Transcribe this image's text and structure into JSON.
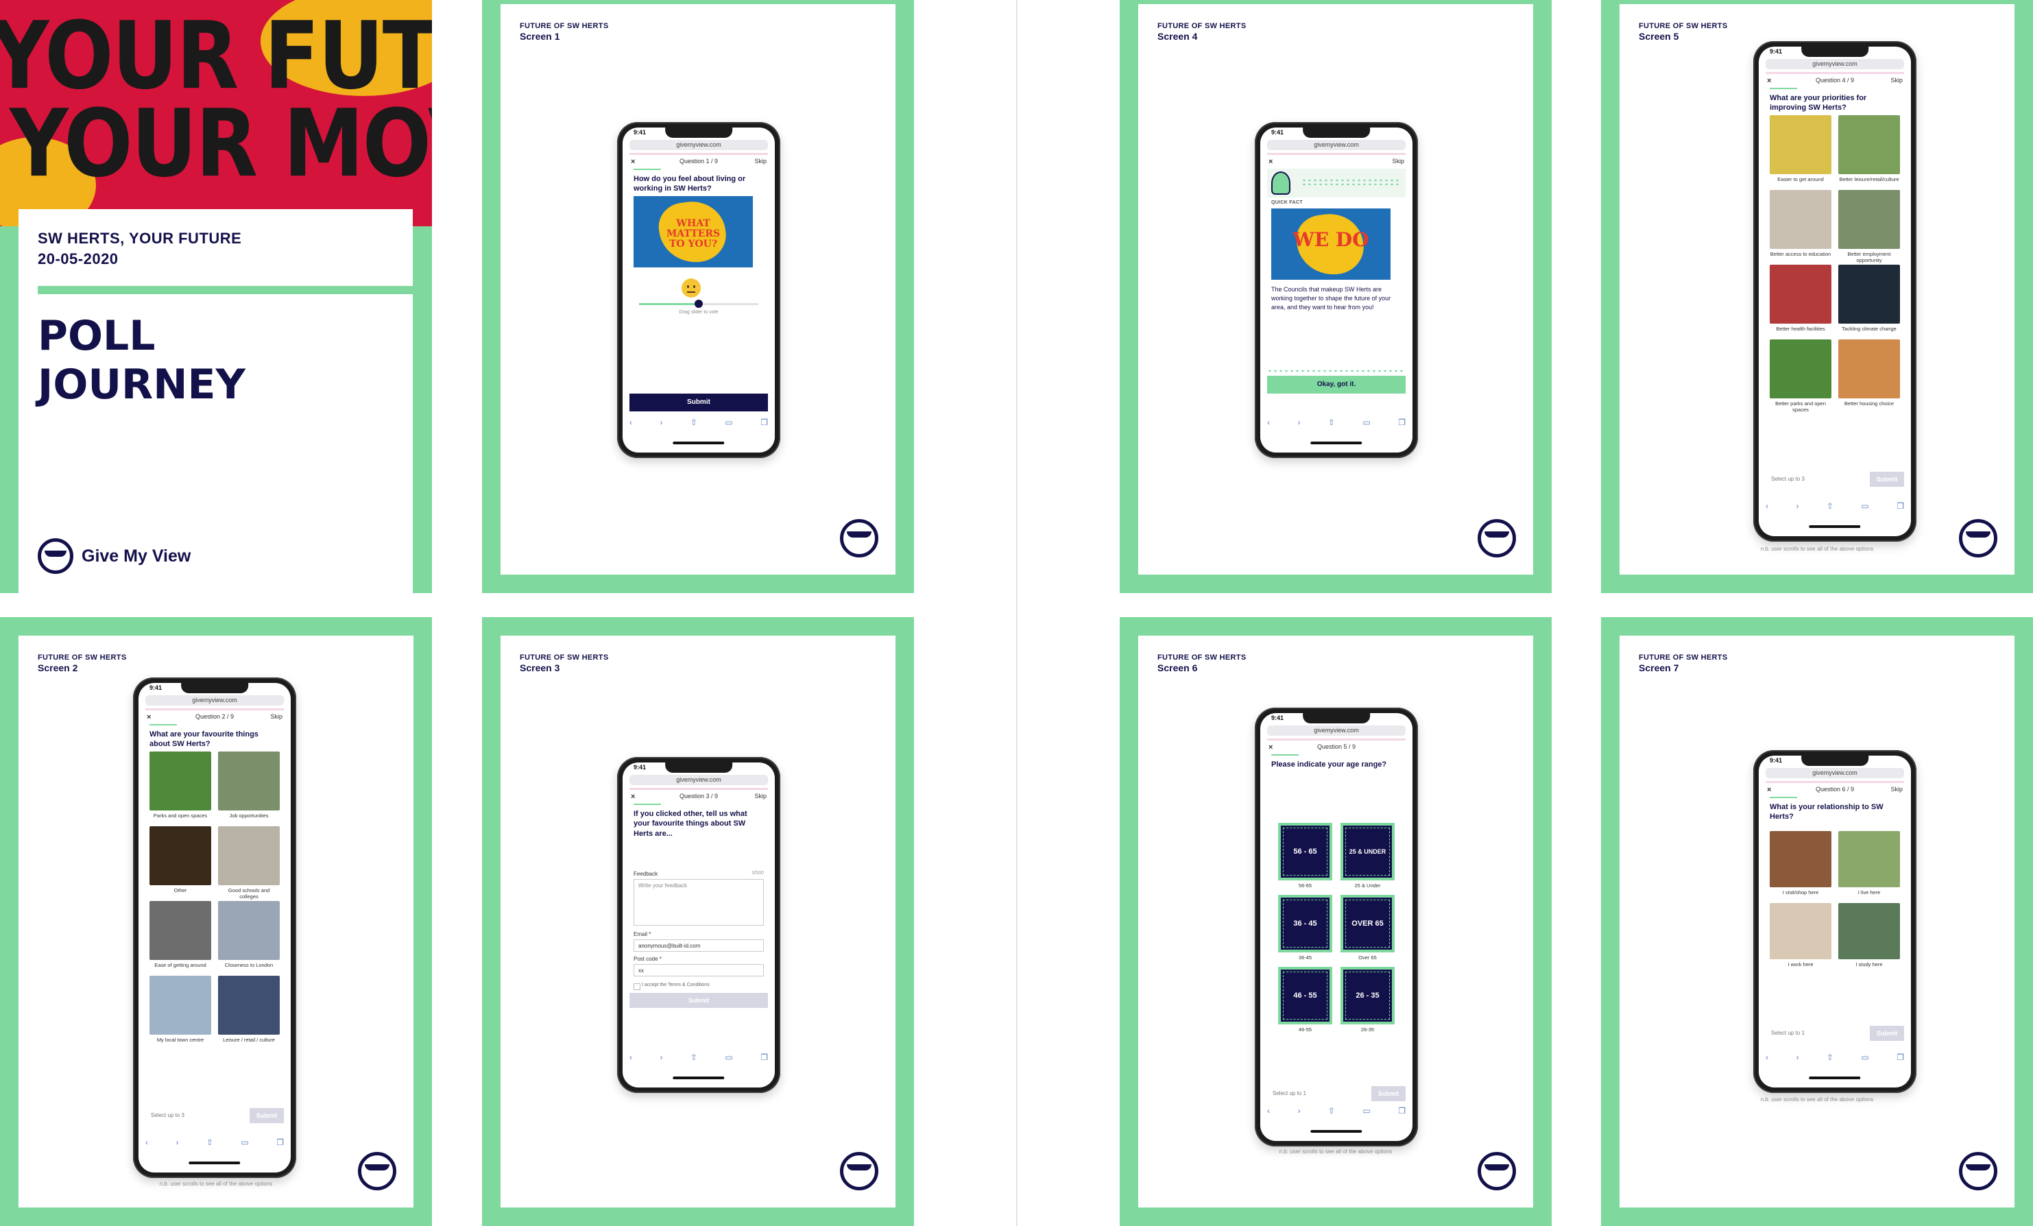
{
  "cover": {
    "poster_line1": "YOUR FUTURE",
    "poster_line2": "YOUR MOVE",
    "subtitle_line1": "SW HERTS, YOUR FUTURE",
    "subtitle_line2": "20-05-2020",
    "title_line1": "POLL",
    "title_line2": "JOURNEY",
    "brand": "Give My View"
  },
  "common": {
    "project": "FUTURE OF SW HERTS",
    "url": "givemyview.com",
    "time": "9:41",
    "skip": "Skip",
    "close": "×",
    "submit": "Submit",
    "select_up_to_3": "Select up to 3",
    "select_up_to_1": "Select up to 1",
    "scroll_hint": "n.b. user scrolls to see all of the above options",
    "toolbar_icons": [
      "back-arrow",
      "forward-arrow",
      "share",
      "bookmarks",
      "tabs"
    ]
  },
  "screen1": {
    "label": "Screen 1",
    "counter": "Question 1 / 9",
    "question": "How do you feel about living or working in SW Herts?",
    "image_text": "WHAT MATTERS TO YOU?",
    "slider_hint": "Drag slider to vote",
    "submit": "Submit"
  },
  "screen2": {
    "label": "Screen 2",
    "counter": "Question 2 / 9",
    "question": "What are your favourite things about SW Herts?",
    "options": [
      {
        "label": "Parks and open spaces",
        "color": "#4f8a3a"
      },
      {
        "label": "Job opportunities",
        "color": "#7a8f6a"
      },
      {
        "label": "Other",
        "color": "#3a2a1a"
      },
      {
        "label": "Good schools and colleges",
        "color": "#b9b2a6"
      },
      {
        "label": "Ease of getting around",
        "color": "#6d6d6d"
      },
      {
        "label": "Closeness to London",
        "color": "#9aa5b5"
      },
      {
        "label": "My local town centre",
        "color": "#9fb3c8"
      },
      {
        "label": "Leisure / retail / culture",
        "color": "#3e4f72"
      }
    ]
  },
  "screen3": {
    "label": "Screen 3",
    "counter": "Question 3 / 9",
    "question": "If you clicked other, tell us what your favourite things about SW Herts are...",
    "feedback_label": "Feedback",
    "feedback_count": "0/500",
    "feedback_placeholder": "Write your feedback",
    "email_label": "Email *",
    "email_value": "anonymous@built-id.com",
    "postcode_label": "Post code *",
    "postcode_value": "xx",
    "terms": "I accept the Terms & Conditions",
    "submit": "Submit"
  },
  "screen4": {
    "label": "Screen 4",
    "fact_label": "QUICK FACT",
    "image_text": "WE DO",
    "fact_text": "The Councils that makeup SW Herts are working together to shape the future of your area, and they want to hear from you!",
    "button": "Okay, got it."
  },
  "screen5": {
    "label": "Screen 5",
    "counter": "Question 4 / 9",
    "question": "What are your priorities for improving SW Herts?",
    "options": [
      {
        "label": "Easier to get around",
        "color": "#d9c04a"
      },
      {
        "label": "Better leisure/retail/culture",
        "color": "#7aa05a"
      },
      {
        "label": "Better access to education",
        "color": "#c9c0b2"
      },
      {
        "label": "Better employment opportunity",
        "color": "#7a8f6a"
      },
      {
        "label": "Better health facilities",
        "color": "#b23a3a"
      },
      {
        "label": "Tackling climate change",
        "color": "#1e2a38"
      },
      {
        "label": "Better parks and open spaces",
        "color": "#4f8a3a"
      },
      {
        "label": "Better housing choice",
        "color": "#d08a4a"
      }
    ]
  },
  "screen6": {
    "label": "Screen 6",
    "counter": "Question 5 / 9",
    "question": "Please indicate your age range?",
    "options": [
      {
        "tile": "56 - 65",
        "label": "56-65"
      },
      {
        "tile": "25 & UNDER",
        "label": "25 & Under"
      },
      {
        "tile": "36 - 45",
        "label": "36-45"
      },
      {
        "tile": "OVER 65",
        "label": "Over 65"
      },
      {
        "tile": "46 - 55",
        "label": "46-55"
      },
      {
        "tile": "26 - 35",
        "label": "26-35"
      }
    ]
  },
  "screen7": {
    "label": "Screen 7",
    "counter": "Question 6 / 9",
    "question": "What is your relationship to SW Herts?",
    "options": [
      {
        "label": "I visit/shop here",
        "color": "#8a5a3a"
      },
      {
        "label": "I live here",
        "color": "#8aa86a"
      },
      {
        "label": "I work here",
        "color": "#d8c8b4"
      },
      {
        "label": "I study here",
        "color": "#5a7a5a"
      }
    ]
  }
}
